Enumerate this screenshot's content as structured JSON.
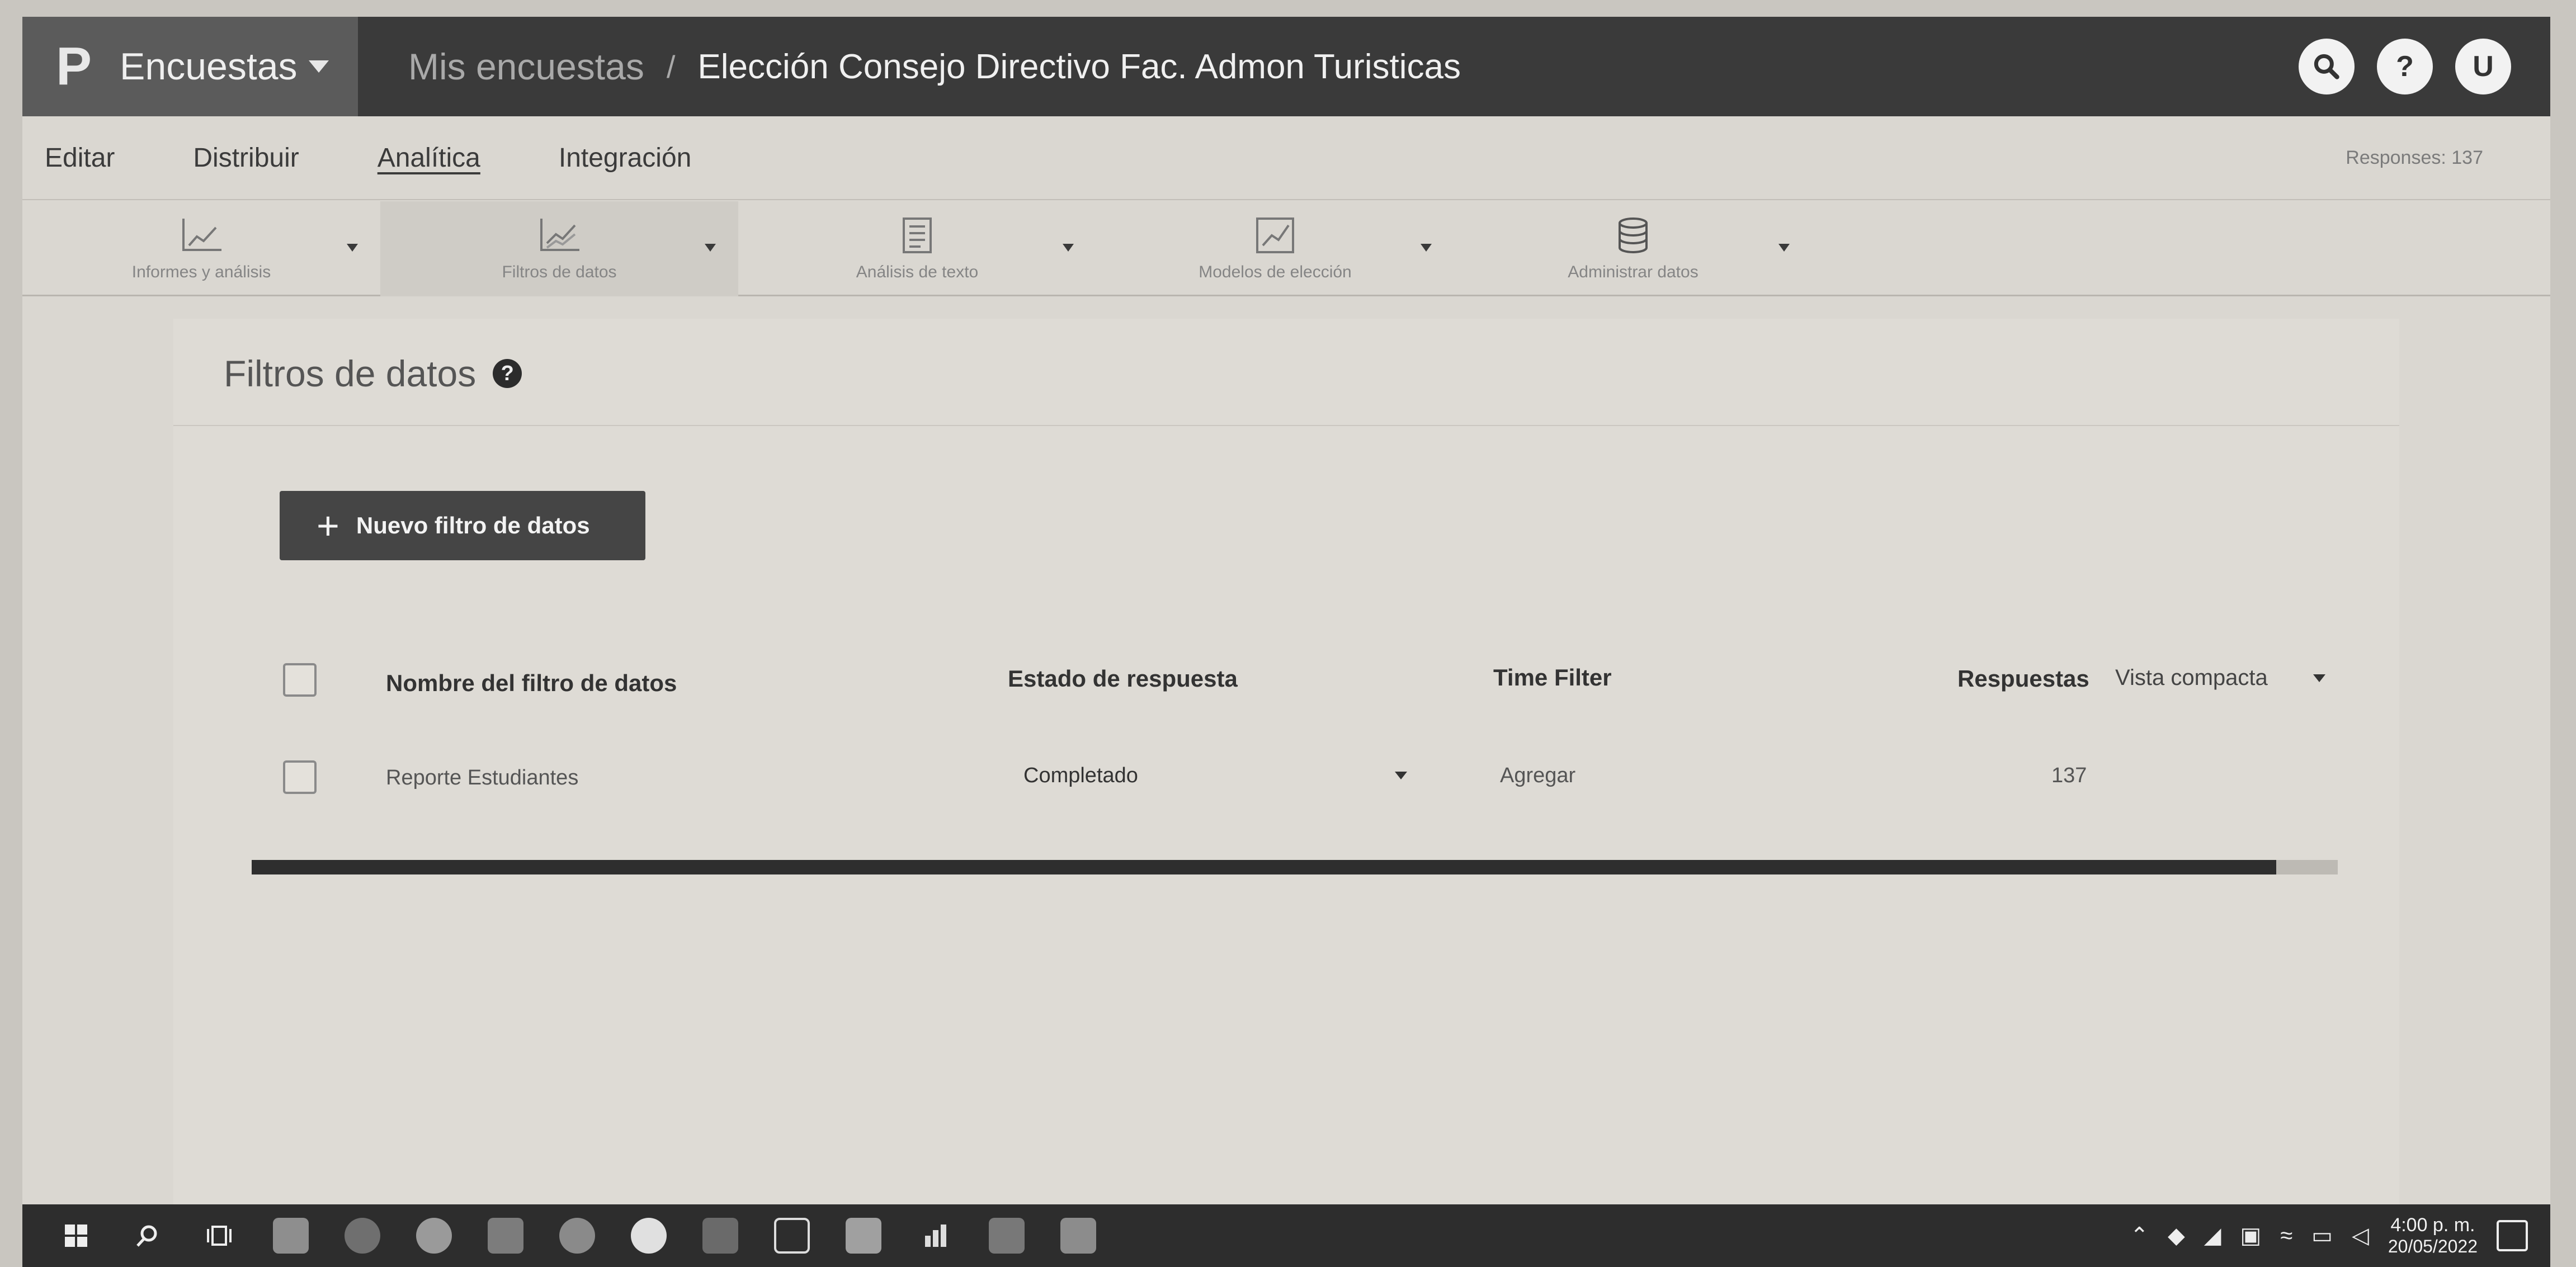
{
  "header": {
    "logo": "P",
    "product": "Encuestas",
    "breadcrumb_root": "Mis encuestas",
    "breadcrumb_sep": "/",
    "survey_title": "Elección Consejo Directivo Fac. Admon Turisticas",
    "icons": [
      "search-icon",
      "help-icon",
      "user-avatar"
    ],
    "user_initial": "U",
    "help_glyph": "?"
  },
  "menu": {
    "items": [
      "Editar",
      "Distribuir",
      "Analítica",
      "Integración"
    ],
    "active": "Analítica",
    "responses": "Responses: 137"
  },
  "toolbar": {
    "tools": [
      {
        "label": "Informes y análisis",
        "icon": "report-chart-icon"
      },
      {
        "label": "Filtros de datos",
        "icon": "data-filter-icon"
      },
      {
        "label": "Análisis de texto",
        "icon": "text-analysis-icon"
      },
      {
        "label": "Modelos de elección",
        "icon": "choice-model-icon"
      },
      {
        "label": "Administrar datos",
        "icon": "database-icon"
      }
    ],
    "active": "Filtros de datos"
  },
  "section": {
    "title": "Filtros de datos",
    "help": "?"
  },
  "new_filter_button": {
    "plus": "+",
    "label": "Nuevo filtro de datos"
  },
  "table": {
    "headers": {
      "name": "Nombre del filtro de datos",
      "status": "Estado de respuesta",
      "time": "Time Filter",
      "responses": "Respuestas"
    },
    "view_mode": "Vista compacta",
    "rows": [
      {
        "name": "Reporte Estudiantes",
        "status": "Completado",
        "time": "Agregar",
        "responses": "137"
      }
    ]
  },
  "taskbar": {
    "apps": [
      "windows-start-icon",
      "search-icon",
      "task-view-icon",
      "file-explorer-icon",
      "edge-icon",
      "chrome-icon",
      "outlook-icon",
      "firefox-icon",
      "app-icon",
      "excel-icon",
      "security-icon",
      "app-icon",
      "power-bi-icon",
      "teams-icon",
      "word-icon"
    ],
    "time": "4:00 p. m.",
    "date": "20/05/2022"
  }
}
